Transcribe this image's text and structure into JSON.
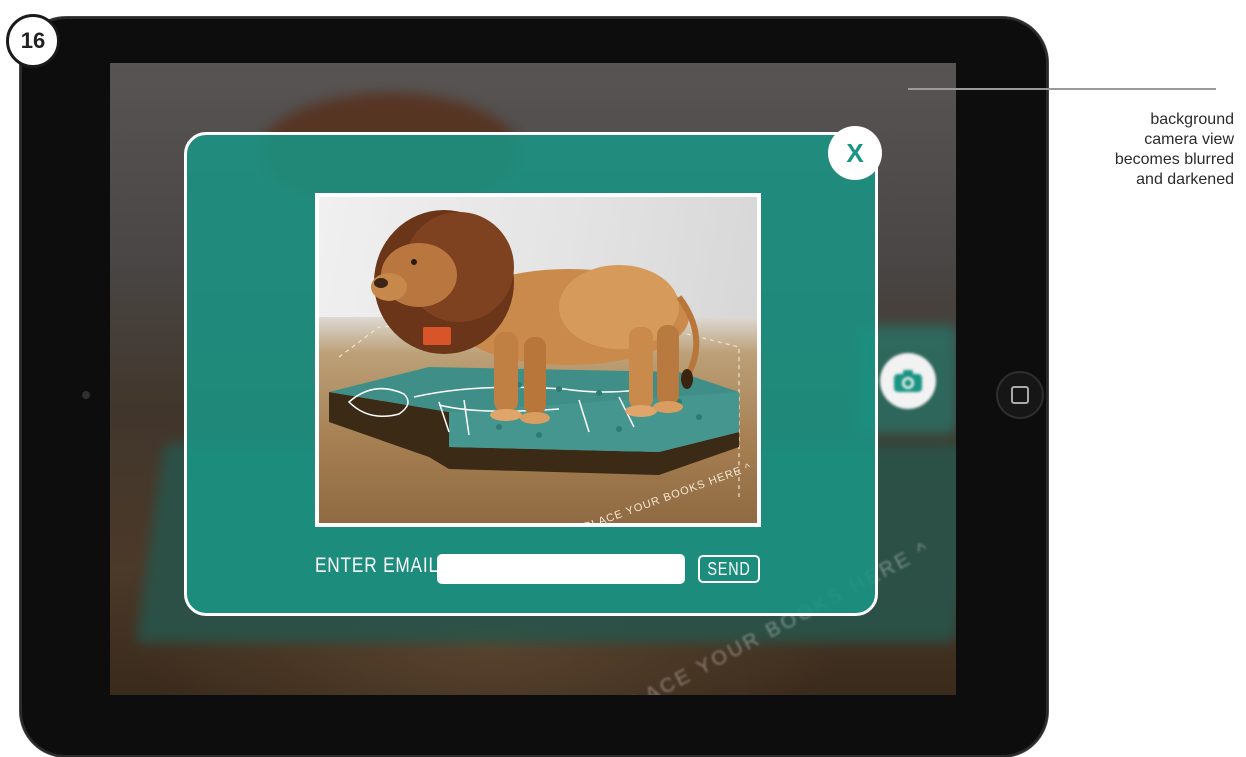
{
  "step": {
    "number": "16"
  },
  "dialog": {
    "close_label": "X",
    "email_label": "ENTER EMAIL",
    "email_value": "",
    "email_placeholder": "",
    "send_label": "SEND",
    "preview_text": "^ PLACE YOUR BOOKS HERE ^",
    "accent_color": "#1a9484"
  },
  "background": {
    "place_text": "^ PLACE YOUR BOOKS HERE ^"
  },
  "annotation": {
    "lines": [
      "background",
      "camera view",
      "becomes blurred",
      "and darkened"
    ]
  },
  "icons": {
    "side_button": "camera-icon",
    "home": "home-button-icon"
  }
}
